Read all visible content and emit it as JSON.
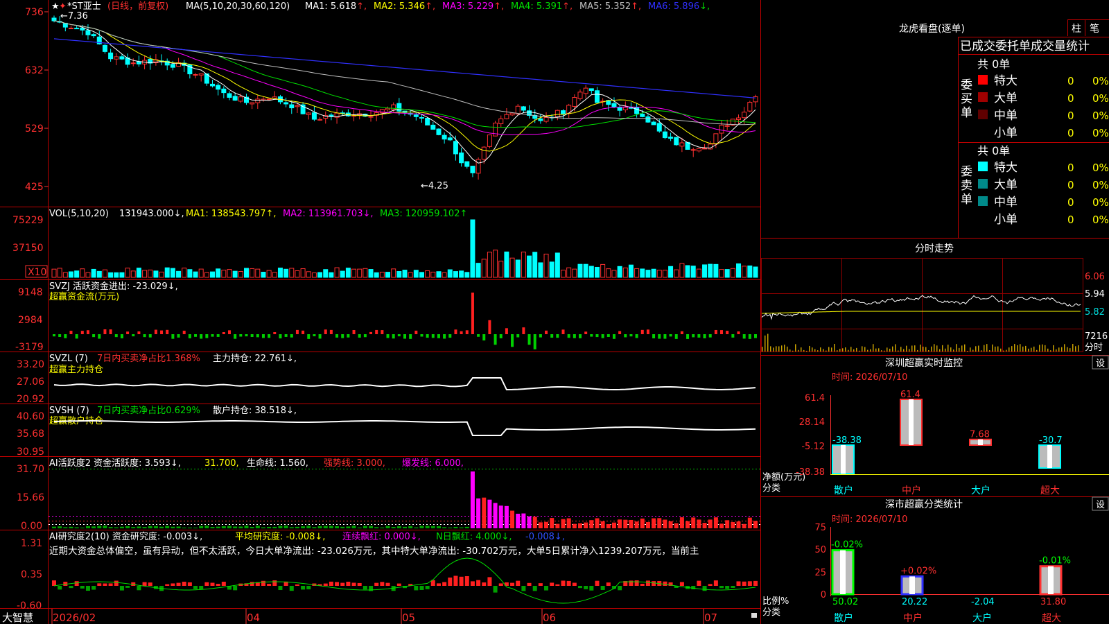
{
  "stock": {
    "name": "*ST亚士",
    "period": "(日线，前复权)",
    "high_marker": "7.36",
    "low_marker": "4.25",
    "ma_header": "MA(5,10,20,30,60,120)",
    "ma_items": [
      {
        "label": "MA1:",
        "value": "5.618",
        "arrow": "↑",
        "color": "#ffffff"
      },
      {
        "label": "MA2:",
        "value": "5.346",
        "arrow": "↑",
        "color": "#ffff00"
      },
      {
        "label": "MA3:",
        "value": "5.229",
        "arrow": "↑",
        "color": "#ff00ff"
      },
      {
        "label": "MA4:",
        "value": "5.391",
        "arrow": "↑",
        "color": "#00e000"
      },
      {
        "label": "MA5:",
        "value": "5.352",
        "arrow": "↑",
        "color": "#c0c0c0"
      },
      {
        "label": "MA6:",
        "value": "5.896",
        "arrow": "↓",
        "color": "#3030ff"
      }
    ],
    "price_ticks": [
      "736",
      "632",
      "529",
      "425"
    ]
  },
  "vol": {
    "header": "VOL(5,10,20)",
    "value": "131943.000↓,",
    "ma1": "MA1: 138543.797↑,",
    "ma2": "MA2: 113961.703↓,",
    "ma3": "MA3: 120959.102↑",
    "ticks": [
      "75229",
      "37150"
    ],
    "x10": "X10"
  },
  "svzj": {
    "header": "SVZJ  活跃资金进出: -23.029↓,",
    "sub": "超赢资金流(万元)",
    "ticks": [
      "9148",
      "2984",
      "-3179"
    ]
  },
  "svzl": {
    "header_a": "SVZL (7)",
    "header_b": "7日内买卖净占比1.368%",
    "header_c": "主力持仓: 22.761↓,",
    "sub": "超赢主力持仓",
    "ticks": [
      "33.20",
      "27.06",
      "20.92"
    ]
  },
  "svsh": {
    "header_a": "SVSH (7)",
    "header_b": "7日内买卖净占比0.629%",
    "header_c": "散户持仓: 38.518↓,",
    "sub": "超赢散户持仓",
    "ticks": [
      "40.60",
      "35.68",
      "30.95"
    ]
  },
  "ai_active": {
    "header_a": "AI活跃度2 资金活跃度: 3.593↓,",
    "header_b": "31.700,",
    "header_c": "生命线: 1.560,",
    "header_d": "强势线: 3.000,",
    "header_e": "爆发线: 6.000,",
    "ticks": [
      "31.70",
      "15.66",
      "0.00"
    ]
  },
  "ai_research": {
    "header_a": "AI研究度2(10) 资金研究度: -0.003↓,",
    "header_b": "平均研究度: -0.008↓,",
    "header_c": "连续飘红: 0.000↓,",
    "header_d": "N日飘红: 4.000↓,",
    "header_e": "-0.008↓,",
    "ticker": "近期大资金总体偏空，虽有异动，但不太活跃，今日大单净流出: -23.026万元，其中特大单净流出: -30.702万元，大单5日累计净入1239.207万元，当前主",
    "ticks": [
      "1.31",
      "0.35",
      "-0.60"
    ]
  },
  "xaxis": {
    "brand": "大智慧",
    "labels": [
      "2026/02",
      "04",
      "05",
      "06",
      "07"
    ]
  },
  "lhb": {
    "title": "龙虎看盘(逐单)",
    "btn_col": "柱",
    "btn_tick": "笔",
    "stats_title": "已成交委托单成交量统计",
    "buy_label": "委买单",
    "sell_label": "委卖单",
    "buy_total": "共 0单",
    "sell_total": "共 0单",
    "buy_rows": [
      {
        "name": "特大",
        "count": "0",
        "pct": "0%",
        "color": "#ff0000"
      },
      {
        "name": "大单",
        "count": "0",
        "pct": "0%",
        "color": "#a00000"
      },
      {
        "name": "中单",
        "count": "0",
        "pct": "0%",
        "color": "#600000"
      },
      {
        "name": "小单",
        "count": "0",
        "pct": "0%",
        "color": ""
      }
    ],
    "sell_rows": [
      {
        "name": "特大",
        "count": "0",
        "pct": "0%",
        "color": "#00ffff"
      },
      {
        "name": "大单",
        "count": "0",
        "pct": "0%",
        "color": "#008a8a"
      },
      {
        "name": "中单",
        "count": "0",
        "pct": "0%",
        "color": "#008a8a"
      },
      {
        "name": "小单",
        "count": "0",
        "pct": "0%",
        "color": ""
      }
    ]
  },
  "intraday": {
    "title": "分时走势",
    "ticks": [
      "6.06",
      "5.94",
      "5.82"
    ],
    "vol_value": "7216",
    "vol_label": "分时"
  },
  "monitor": {
    "title": "深圳超赢实时监控",
    "btn": "设",
    "time": "时间: 2026/07/10",
    "y_ticks": [
      "61.4",
      "28.14",
      "-5.12",
      "-38.38"
    ],
    "ylabel": "净额(万元)",
    "xlabel": "分类",
    "categories": [
      "散户",
      "中户",
      "大户",
      "超大"
    ],
    "values": [
      -38.38,
      61.4,
      7.68,
      -30.7
    ],
    "value_labels": [
      "-38.38",
      "61.4",
      "7.68",
      "-30.7"
    ]
  },
  "classify": {
    "title": "深市超赢分类统计",
    "btn": "设",
    "time": "时间: 2026/07/10",
    "y_ticks": [
      "75",
      "50",
      "25",
      "0"
    ],
    "ylabel": "比例%",
    "xlabel": "分类",
    "categories": [
      "散户",
      "中户",
      "大户",
      "超大"
    ],
    "values": [
      50.02,
      20.22,
      -2.04,
      31.8
    ],
    "value_labels": [
      "50.02",
      "20.22",
      "-2.04",
      "31.80"
    ],
    "change_labels": [
      "-0.02%",
      "+0.02%",
      "",
      "-0.01%"
    ]
  }
}
